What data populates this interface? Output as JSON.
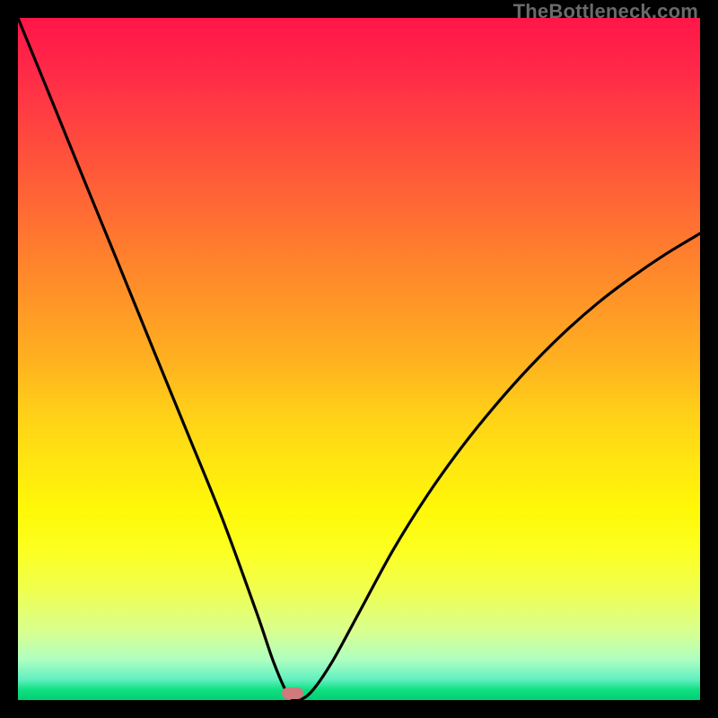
{
  "watermark": "TheBottleneck.com",
  "colors": {
    "frame": "#000000",
    "curve": "#000000",
    "marker": "#cf7a7c",
    "gradient_top": "#ff1648",
    "gradient_bottom": "#00d074"
  },
  "marker": {
    "x_frac": 0.403,
    "y_frac": 0.989
  },
  "chart_data": {
    "type": "line",
    "title": "",
    "xlabel": "",
    "ylabel": "",
    "xlim": [
      0,
      1
    ],
    "ylim": [
      0,
      1
    ],
    "grid": false,
    "legend": false,
    "series": [
      {
        "name": "bottleneck-curve",
        "x": [
          0.0,
          0.05,
          0.1,
          0.15,
          0.2,
          0.25,
          0.3,
          0.35,
          0.375,
          0.395,
          0.41,
          0.43,
          0.46,
          0.5,
          0.55,
          0.6,
          0.65,
          0.7,
          0.75,
          0.8,
          0.85,
          0.9,
          0.95,
          1.0
        ],
        "y": [
          1.0,
          0.878,
          0.755,
          0.633,
          0.51,
          0.388,
          0.265,
          0.128,
          0.055,
          0.01,
          0.0,
          0.012,
          0.055,
          0.128,
          0.22,
          0.3,
          0.37,
          0.432,
          0.488,
          0.538,
          0.582,
          0.62,
          0.654,
          0.684
        ]
      }
    ],
    "annotations": [
      {
        "type": "marker",
        "x": 0.403,
        "y": 0.011,
        "shape": "rounded-rect",
        "color": "#cf7a7c"
      }
    ]
  }
}
